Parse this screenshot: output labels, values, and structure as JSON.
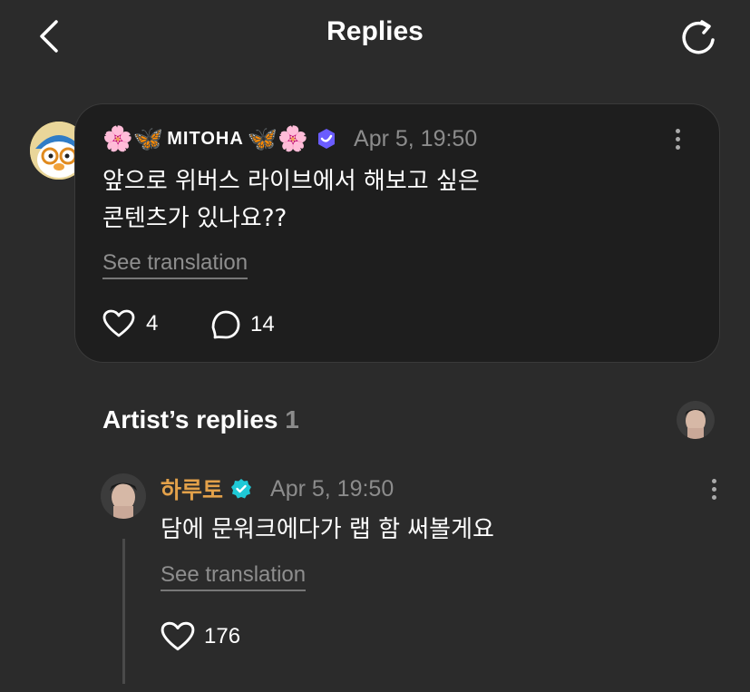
{
  "header": {
    "title": "Replies"
  },
  "comment": {
    "emoji_left": "🌸🦋",
    "handle": "MITOHA",
    "emoji_right": "🦋🌸",
    "time": "Apr 5, 19:50",
    "text_line1": "앞으로 위버스 라이브에서 해보고 싶은",
    "text_line2": "콘텐츠가 있나요??",
    "see_translation": "See translation",
    "likes": "4",
    "replies": "14"
  },
  "artist_section": {
    "title": "Artist’s replies",
    "count": "1"
  },
  "reply": {
    "name": "하루토",
    "time": "Apr 5, 19:50",
    "text": "담에 문워크에다가 랩 함 써볼게요",
    "see_translation": "See translation",
    "likes": "176"
  },
  "colors": {
    "background": "#2b2b2b",
    "card": "#1e1e1e",
    "artist_name": "#e3a14a",
    "verified": "#1fc9d6",
    "badge": "#6a5cff"
  }
}
